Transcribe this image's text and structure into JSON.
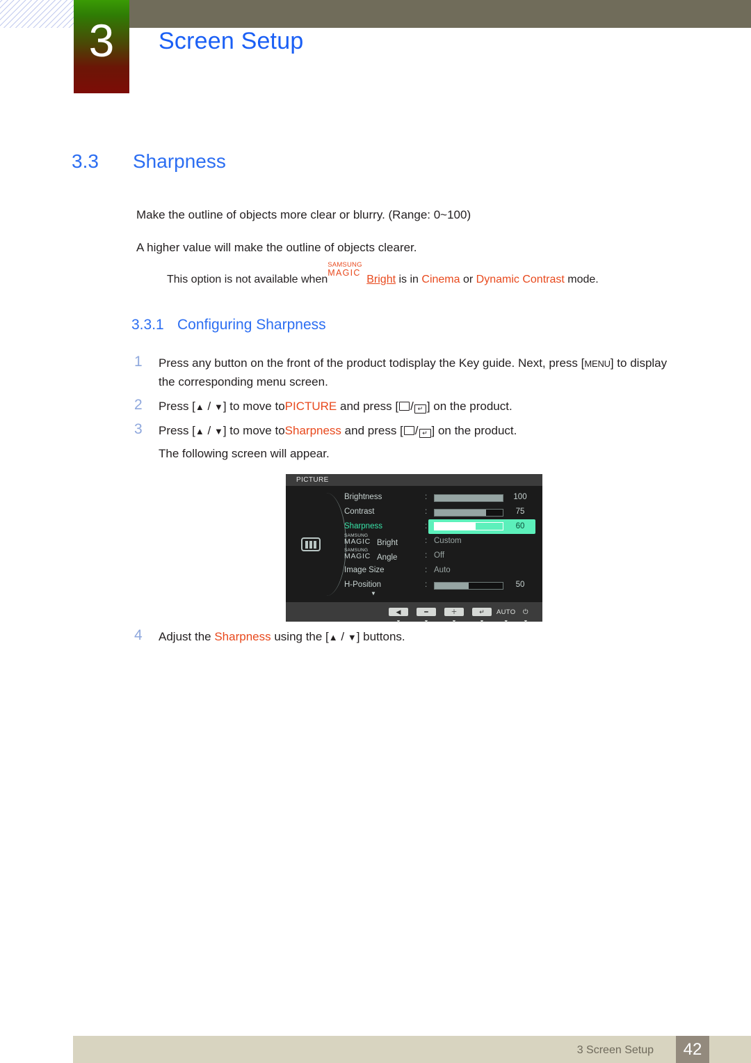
{
  "chapter": {
    "number": "3",
    "title": "Screen Setup"
  },
  "section": {
    "number": "3.3",
    "title": "Sharpness"
  },
  "paragraphs": {
    "p1": "Make the outline of objects more clear or blurry. (Range: 0~100)",
    "p2": "A higher value will make the outline of objects clearer."
  },
  "note": {
    "lead": "This option is not available when",
    "magic_top": "SAMSUNG",
    "magic_bottom": "MAGIC",
    "bright": "Bright",
    "mid": " is in ",
    "mode1": "Cinema",
    "conj": " or ",
    "mode2": "Dynamic Contrast",
    "tail": " mode."
  },
  "subsection": {
    "number": "3.3.1",
    "title": "Configuring Sharpness"
  },
  "steps": [
    {
      "num": "1",
      "line1_a": "Press any button on the front of the product to",
      "line1_b": "display the Key guide. Ne",
      "line1_c": "xt, press [",
      "menu_key": "MENU",
      "line1_d": "] to display",
      "line2": "the corresponding menu screen."
    },
    {
      "num": "2",
      "pre": "Press [",
      "up": "▲",
      "sep": " / ",
      "down": "▼",
      "mid": "] to move to",
      "target": "PICTURE",
      "post": " and press [",
      "tail": "] on the product."
    },
    {
      "num": "3",
      "pre": "Press [",
      "up": "▲",
      "sep": " / ",
      "down": "▼",
      "mid": "] to move to",
      "target": "Sharpness",
      "post": " and press [",
      "tail": "] on the product.",
      "extra": "The following screen will appear."
    },
    {
      "num": "4",
      "pre": "Adjust the ",
      "target": "Sharpness",
      "mid": " using the [",
      "up": "▲",
      "sep": " / ",
      "down": "▼",
      "tail": "] buttons."
    }
  ],
  "osd": {
    "title": "PICTURE",
    "down_arrow": "▼",
    "rows": [
      {
        "label": "Brightness",
        "type": "slider",
        "value": "100",
        "fill": 100
      },
      {
        "label": "Contrast",
        "type": "slider",
        "value": "75",
        "fill": 75
      },
      {
        "label": "Sharpness",
        "type": "slider-selected",
        "value": "60",
        "fill": 60
      },
      {
        "label": "Bright",
        "type": "magic-text",
        "value": "Custom",
        "magic_top": "SAMSUNG",
        "magic_bottom": "MAGIC"
      },
      {
        "label": "Angle",
        "type": "magic-text",
        "value": "Off",
        "magic_top": "SAMSUNG",
        "magic_bottom": "MAGIC"
      },
      {
        "label": "Image Size",
        "type": "text",
        "value": "Auto"
      },
      {
        "label": "H-Position",
        "type": "slider",
        "value": "50",
        "fill": 50
      }
    ],
    "colon": ":",
    "buttons": [
      {
        "glyph": "◀",
        "kind": "key",
        "tri": "▼"
      },
      {
        "glyph": "━",
        "kind": "key",
        "tri": "▼"
      },
      {
        "glyph": "＋",
        "kind": "key",
        "tri": "▼"
      },
      {
        "glyph": "↵",
        "kind": "key",
        "tri": "▼"
      },
      {
        "glyph": "AUTO",
        "kind": "text",
        "tri": "▼"
      },
      {
        "glyph": "⏻",
        "kind": "text",
        "tri": "▼"
      }
    ]
  },
  "footer": {
    "label": "3 Screen Setup",
    "page": "42"
  },
  "colors": {
    "heading_blue": "#2c6ef2",
    "accent_orange": "#e8491d",
    "olive_bar": "#706c5a",
    "footer_bar": "#d8d4c0",
    "page_box": "#938a7d",
    "osd_highlight": "#5cf0bb",
    "step_number": "#8fa8dd"
  }
}
